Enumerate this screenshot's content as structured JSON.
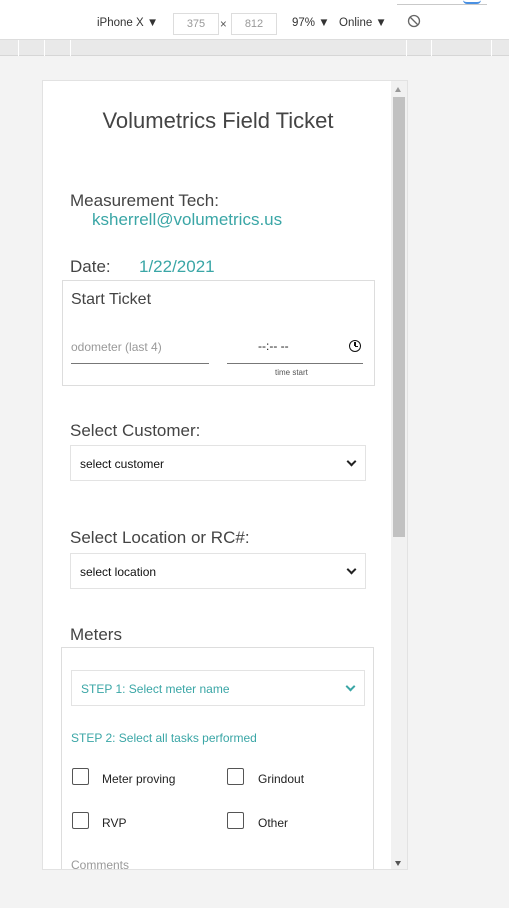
{
  "devtools": {
    "device": "iPhone X ▼",
    "width": "375",
    "times": "×",
    "height": "812",
    "zoom": "97% ▼",
    "network": "Online ▼"
  },
  "page": {
    "title": "Volumetrics Field Ticket",
    "tech_label": "Measurement Tech:",
    "tech_email": "ksherrell@volumetrics.us",
    "date_label": "Date:",
    "date_value": "1/22/2021",
    "start_ticket": {
      "heading": "Start Ticket",
      "odometer_placeholder": "odometer (last 4)",
      "time_value": "--:-- --",
      "time_caption": "time start"
    },
    "customer": {
      "label": "Select Customer:",
      "selected": "select customer"
    },
    "location": {
      "label": "Select Location or RC#:",
      "selected": "select location"
    },
    "meters": {
      "label": "Meters",
      "step1": "STEP 1: Select meter name",
      "step2": "STEP 2: Select all tasks performed",
      "tasks": [
        "Meter proving",
        "Grindout",
        "RVP",
        "Other"
      ],
      "comments_label": "Comments"
    }
  }
}
